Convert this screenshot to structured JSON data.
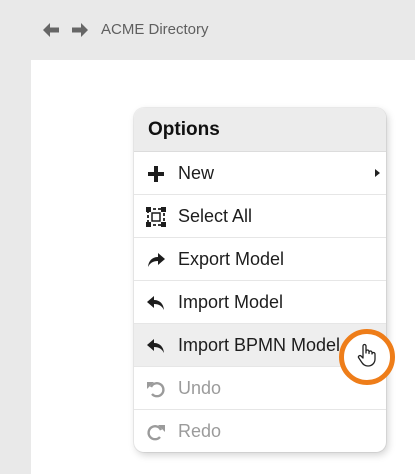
{
  "topbar": {
    "back_icon": "arrow-left-icon",
    "forward_icon": "arrow-right-icon",
    "breadcrumb": "ACME Directory"
  },
  "menu": {
    "title": "Options",
    "items": [
      {
        "label": "New",
        "icon": "plus-icon",
        "has_submenu": true,
        "enabled": true
      },
      {
        "label": "Select All",
        "icon": "select-all-icon",
        "enabled": true
      },
      {
        "label": "Export Model",
        "icon": "share-forward-icon",
        "enabled": true
      },
      {
        "label": "Import Model",
        "icon": "reply-icon",
        "enabled": true
      },
      {
        "label": "Import BPMN Model",
        "icon": "reply-icon",
        "enabled": true,
        "hovered": true
      },
      {
        "label": "Undo",
        "icon": "undo-icon",
        "enabled": false
      },
      {
        "label": "Redo",
        "icon": "redo-icon",
        "enabled": false
      }
    ]
  },
  "colors": {
    "accent": "#ee7d19",
    "background": "#e9e9e9",
    "disabled_text": "#9b9b9b"
  },
  "cursor": {
    "icon": "hand-pointer-icon"
  }
}
